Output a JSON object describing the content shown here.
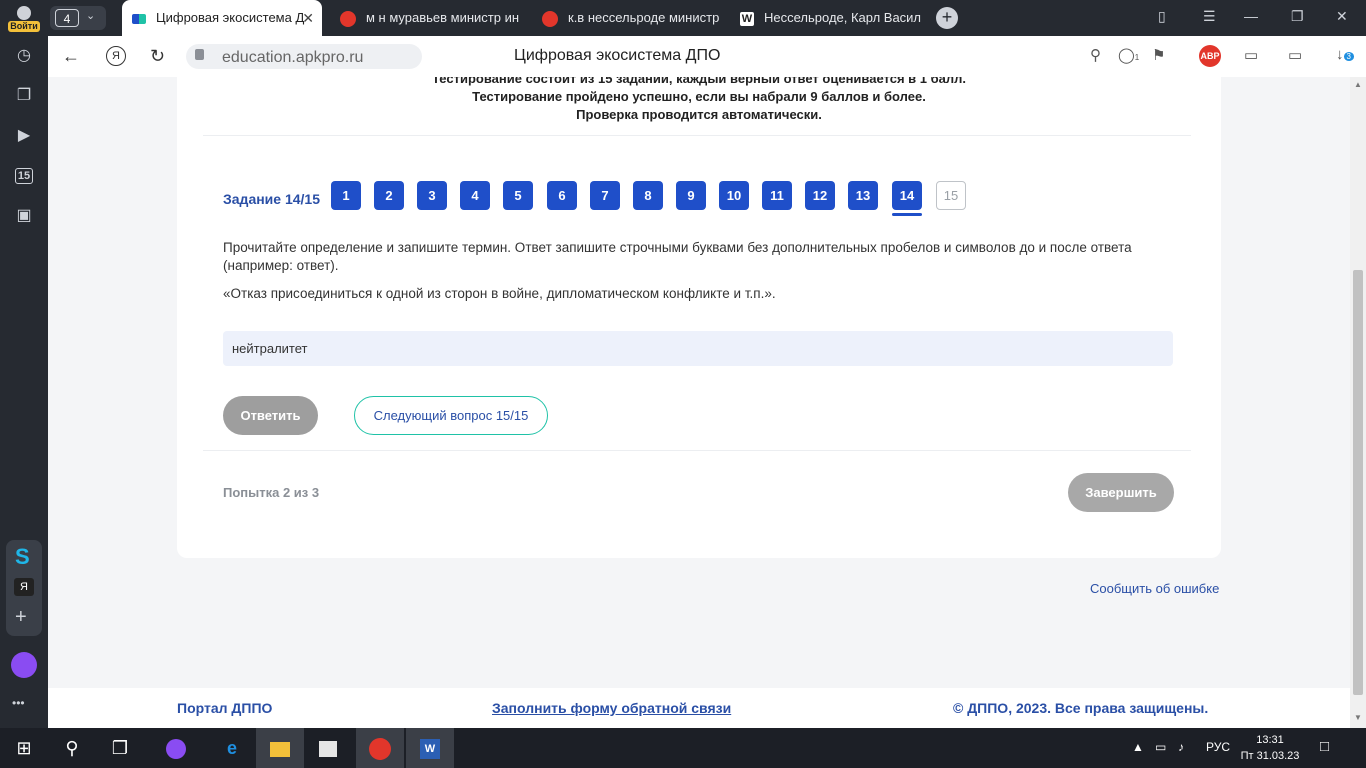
{
  "sidebar": {
    "login_label": "Войти",
    "calendar_day": "15",
    "yandex_letter": "Я",
    "more_label": "•••"
  },
  "tabs": {
    "count": "4",
    "items": [
      {
        "title": "Цифровая экосистема Д"
      },
      {
        "title": "м н муравьев министр ин"
      },
      {
        "title": "к.в нессельроде министр"
      },
      {
        "title": "Нессельроде, Карл Васил"
      }
    ]
  },
  "addressbar": {
    "url": "education.apkpro.ru",
    "page_title": "Цифровая экосистема ДПО",
    "abp_label": "ABP",
    "reader_badge": "1",
    "downloads_badge": "3"
  },
  "rules": {
    "line1": "Тестирование состоит из 15 заданий, каждый верный ответ оценивается в 1 балл.",
    "line2": "Тестирование пройдено успешно, если вы набрали 9 баллов и более.",
    "line3": "Проверка проводится автоматически."
  },
  "question": {
    "label": "Задание 14/15",
    "numbers": [
      "1",
      "2",
      "3",
      "4",
      "5",
      "6",
      "7",
      "8",
      "9",
      "10",
      "11",
      "12",
      "13",
      "14",
      "15"
    ],
    "current": 14,
    "instruction": "Прочитайте определение и запишите термин. Ответ запишите строчными буквами без дополнительных пробелов и символов до и после ответа (например: ответ).",
    "definition": "«Отказ присоединиться к одной из сторон в войне, дипломатическом конфликте и т.п.».",
    "answer_value": "нейтралитет"
  },
  "buttons": {
    "answer": "Ответить",
    "next": "Следующий вопрос 15/15",
    "finish": "Завершить"
  },
  "attempt": "Попытка 2 из 3",
  "report_error": "Сообщить об ошибке",
  "footer": {
    "portal": "Портал ДППО",
    "feedback": "Заполнить форму обратной связи",
    "copyright": "© ДППО, 2023. Все права защищены."
  },
  "taskbar": {
    "lang": "РУС",
    "time": "13:31",
    "date": "Пт 31.03.23"
  },
  "colors": {
    "accent": "#1f4fc9",
    "link": "#2a4fa6",
    "outline": "#1fc2a7"
  }
}
